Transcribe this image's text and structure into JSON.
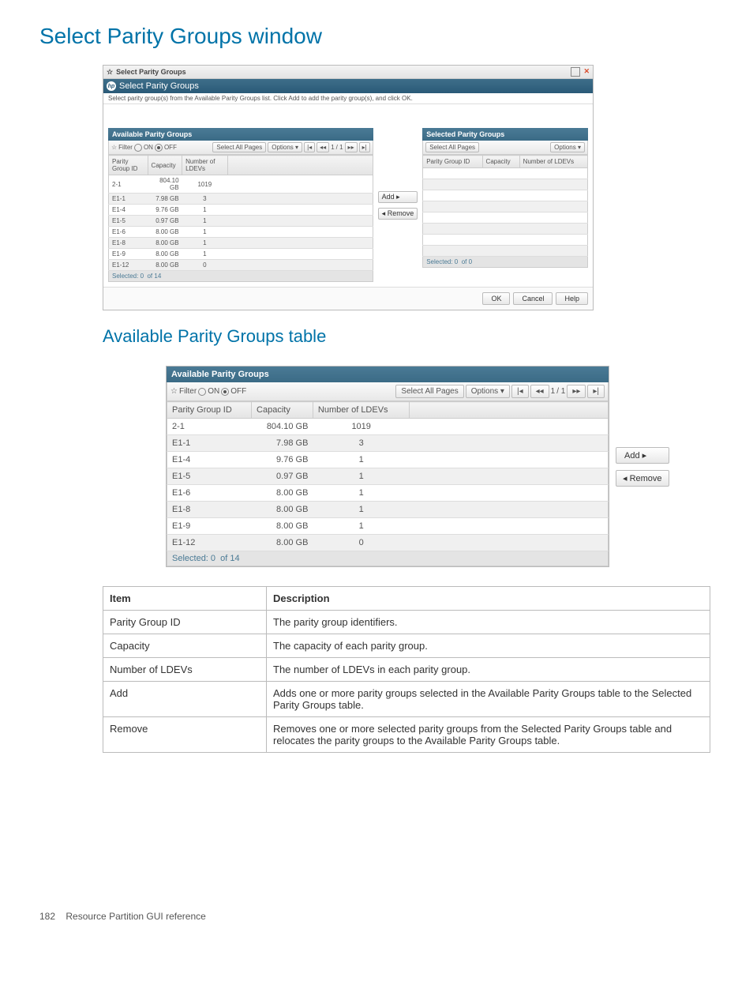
{
  "page_title": "Select Parity Groups window",
  "section_title": "Available Parity Groups table",
  "footer_page": "182",
  "footer_text": "Resource Partition GUI reference",
  "dialog": {
    "win_title": "Select Parity Groups",
    "hp_title": "Select Parity Groups",
    "instruction": "Select parity group(s) from the Available Parity Groups list. Click Add to add the parity group(s), and click OK.",
    "ok": "OK",
    "cancel": "Cancel",
    "help": "Help"
  },
  "available_panel": {
    "title": "Available Parity Groups",
    "filter_label": "Filter",
    "on": "ON",
    "off": "OFF",
    "select_all": "Select All Pages",
    "options": "Options",
    "page_current": "1",
    "page_total": "/ 1",
    "col1": "Parity Group ID",
    "col2": "Capacity",
    "col3": "Number of LDEVs",
    "rows": [
      {
        "id": "2-1",
        "cap": "804.10 GB",
        "n": "1019"
      },
      {
        "id": "E1-1",
        "cap": "7.98 GB",
        "n": "3"
      },
      {
        "id": "E1-4",
        "cap": "9.76 GB",
        "n": "1"
      },
      {
        "id": "E1-5",
        "cap": "0.97 GB",
        "n": "1"
      },
      {
        "id": "E1-6",
        "cap": "8.00 GB",
        "n": "1"
      },
      {
        "id": "E1-8",
        "cap": "8.00 GB",
        "n": "1"
      },
      {
        "id": "E1-9",
        "cap": "8.00 GB",
        "n": "1"
      },
      {
        "id": "E1-12",
        "cap": "8.00 GB",
        "n": "0"
      }
    ],
    "status_sel": "Selected: 0",
    "status_of": "of 14"
  },
  "selected_panel": {
    "title": "Selected Parity Groups",
    "select_all": "Select All Pages",
    "options": "Options",
    "col1": "Parity Group ID",
    "col2": "Capacity",
    "col3": "Number of LDEVs",
    "status_sel": "Selected: 0",
    "status_of": "of 0"
  },
  "add_btn": "Add ▸",
  "remove_btn": "◂ Remove",
  "desc": {
    "h_item": "Item",
    "h_desc": "Description",
    "rows": [
      {
        "i": "Parity Group ID",
        "d": "The parity group identifiers."
      },
      {
        "i": "Capacity",
        "d": "The capacity of each parity group."
      },
      {
        "i": "Number of LDEVs",
        "d": "The number of LDEVs in each parity group."
      },
      {
        "i": "Add",
        "d": "Adds one or more parity groups selected in the Available Parity Groups table to the Selected Parity Groups table."
      },
      {
        "i": "Remove",
        "d": "Removes one or more selected parity groups from the Selected Parity Groups table and relocates the parity groups to the Available Parity Groups table."
      }
    ]
  }
}
